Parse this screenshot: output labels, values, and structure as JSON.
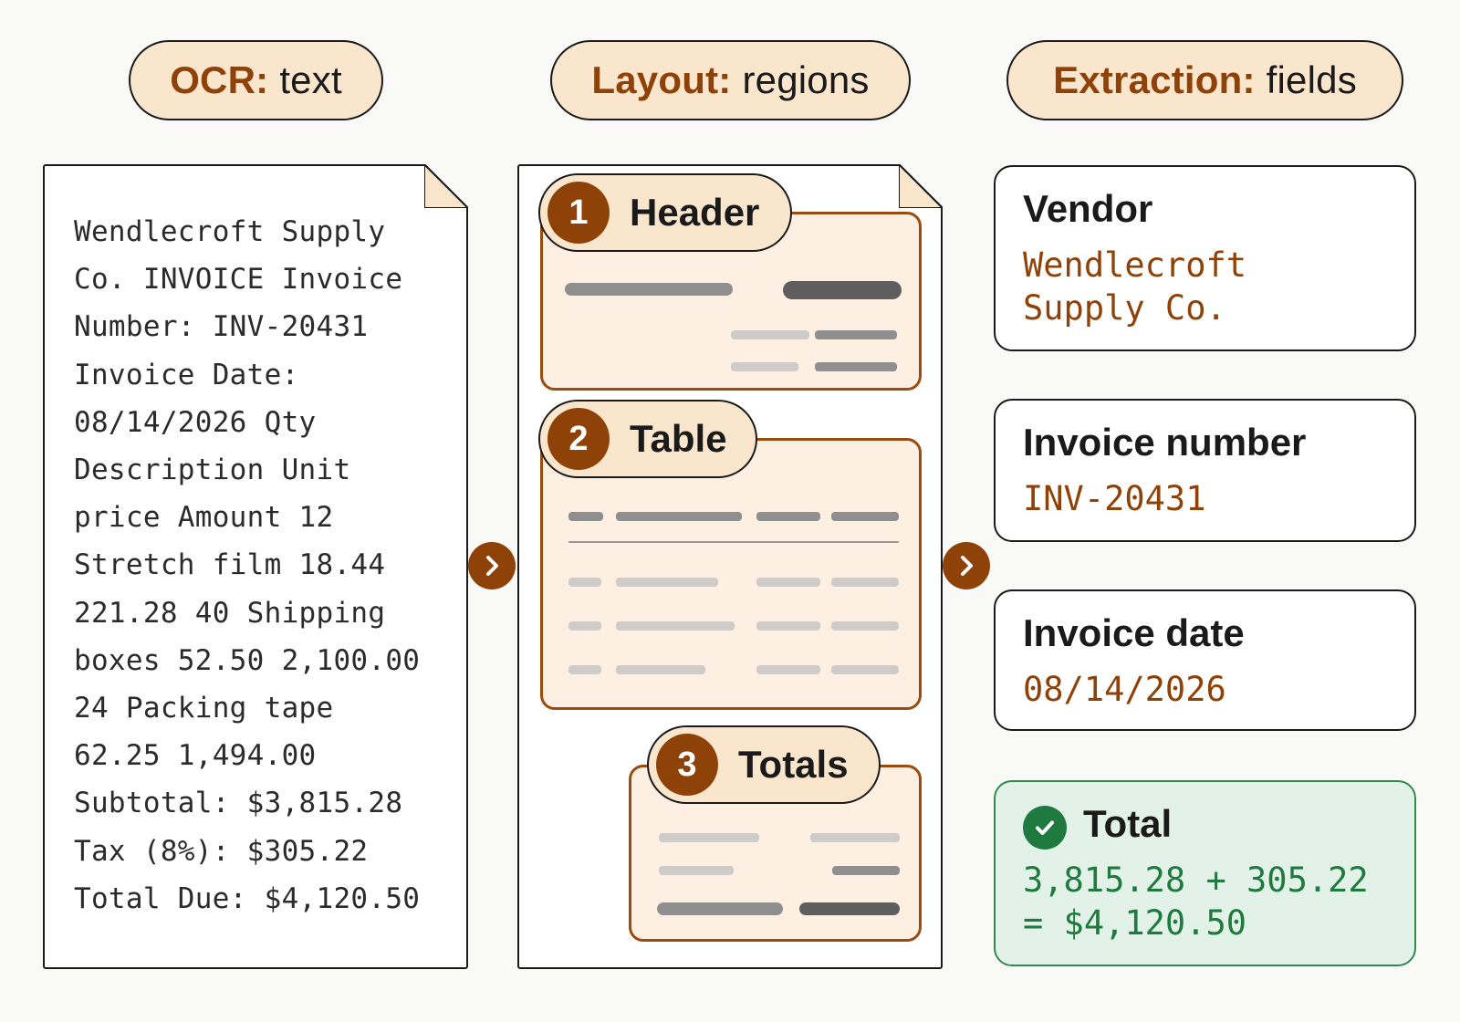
{
  "columns": {
    "ocr": {
      "key": "OCR:",
      "value": "text"
    },
    "layout": {
      "key": "Layout:",
      "value": "regions"
    },
    "extraction": {
      "key": "Extraction:",
      "value": "fields"
    }
  },
  "ocr_lines": [
    "Wendlecroft Supply",
    "Co. INVOICE Invoice",
    "Number: INV-20431",
    "Invoice Date:",
    "08/14/2026 Qty",
    "Description Unit",
    "price Amount 12",
    "Stretch film 18.44",
    "221.28 40 Shipping",
    "boxes 52.50 2,100.00",
    "24 Packing tape",
    "62.25 1,494.00",
    "Subtotal: $3,815.28",
    "Tax (8%): $305.22",
    "Total Due: $4,120.50"
  ],
  "regions": [
    {
      "number": "1",
      "label": "Header"
    },
    {
      "number": "2",
      "label": "Table"
    },
    {
      "number": "3",
      "label": "Totals"
    }
  ],
  "fields": {
    "vendor": {
      "title": "Vendor",
      "value": "Wendlecroft\nSupply Co."
    },
    "invoice_number": {
      "title": "Invoice number",
      "value": "INV-20431"
    },
    "invoice_date": {
      "title": "Invoice date",
      "value": "08/14/2026"
    },
    "total": {
      "title": "Total",
      "value": "3,815.28 + 305.22\n= $4,120.50"
    }
  },
  "colors": {
    "accent": "#8f4208",
    "pill_fill": "#fae5cd",
    "region_fill": "#fdf0e3",
    "success": "#1f7a3e",
    "success_fill": "#e3f2e8"
  },
  "icons": [
    "chevron-right-icon",
    "check-circle-icon",
    "folded-corner-icon"
  ]
}
